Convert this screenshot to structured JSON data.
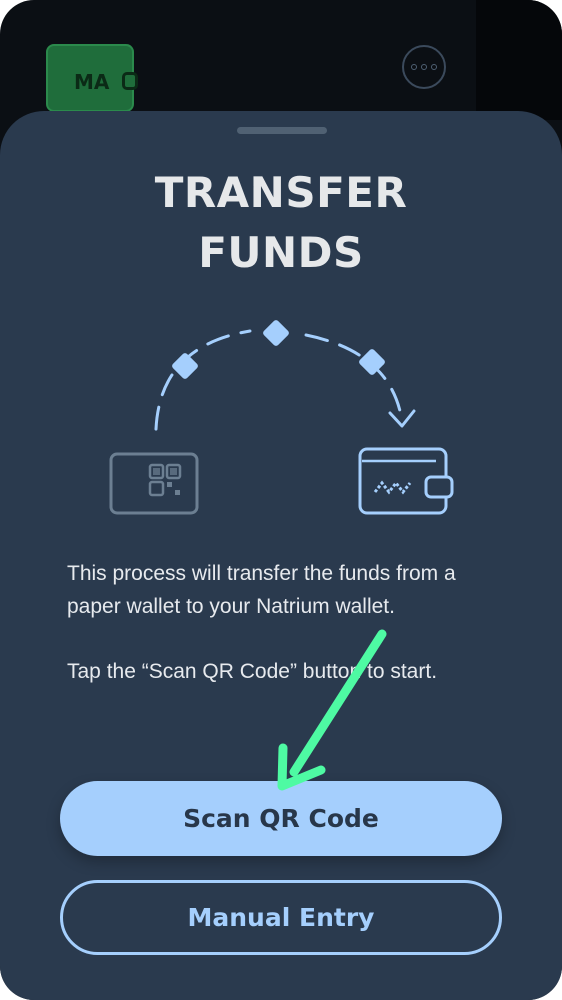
{
  "background": {
    "wallet_label": "MA",
    "more_icon": "more-dots-icon"
  },
  "sheet": {
    "title": "TRANSFER\nFUNDS",
    "description_1": "This process will transfer the funds from a paper wallet to your Natrium wallet.",
    "description_2": "Tap the “Scan QR Code” button to start.",
    "primary_button": "Scan QR Code",
    "secondary_button": "Manual Entry"
  },
  "colors": {
    "sheet_bg": "#2a3a4e",
    "accent": "#a5cffd",
    "annotation_arrow": "#4efaa3"
  }
}
